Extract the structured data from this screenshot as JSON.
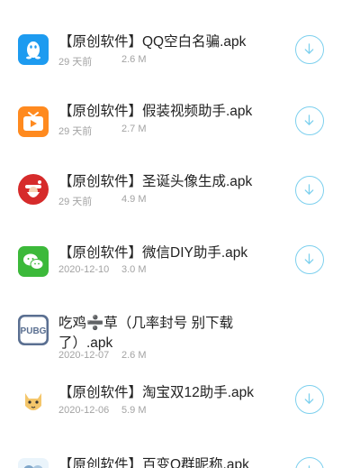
{
  "download_list": {
    "items": [
      {
        "title": "【原创软件】QQ空白名骗.apk",
        "date": "29 天前",
        "size": "2.6 M",
        "icon": "qq-penguin-icon"
      },
      {
        "title": "【原创软件】假装视频助手.apk",
        "date": "29 天前",
        "size": "2.7 M",
        "icon": "video-tv-icon"
      },
      {
        "title": "【原创软件】圣诞头像生成.apk",
        "date": "29 天前",
        "size": "4.9 M",
        "icon": "santa-claus-icon"
      },
      {
        "title": "【原创软件】微信DIY助手.apk",
        "date": "2020-12-10",
        "size": "3.0 M",
        "icon": "wechat-icon"
      },
      {
        "title": "吃鸡➗草（几率封号 别下载了）.apk",
        "date": "2020-12-07",
        "size": "2.6 M",
        "icon": "pubg-icon"
      },
      {
        "title": "【原创软件】淘宝双12助手.apk",
        "date": "2020-12-06",
        "size": "5.9 M",
        "icon": "cat-mascot-icon"
      },
      {
        "title": "【原创软件】百变Q群昵称.apk",
        "icon": "qq-group-icon"
      }
    ]
  },
  "colors": {
    "download_ring": "#7dd0ee",
    "meta_text": "#a3a3a3",
    "title_text": "#222222"
  }
}
